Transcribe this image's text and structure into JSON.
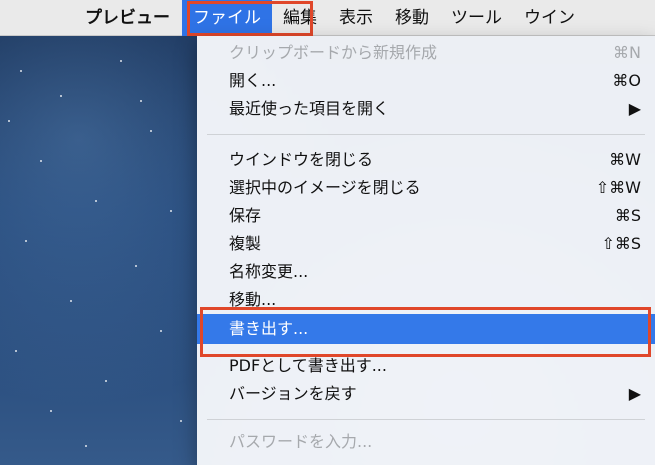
{
  "menubar": {
    "app_name": "プレビュー",
    "items": [
      "ファイル",
      "編集",
      "表示",
      "移動",
      "ツール",
      "ウイン"
    ],
    "active_item": "ファイル"
  },
  "file_menu": {
    "items": [
      {
        "label": "クリップボードから新規作成",
        "shortcut": "⌘N",
        "disabled": true
      },
      {
        "label": "開く...",
        "shortcut": "⌘O"
      },
      {
        "label": "最近使った項目を開く",
        "shortcut": "▶"
      },
      {
        "label": "ウインドウを閉じる",
        "shortcut": "⌘W"
      },
      {
        "label": "選択中のイメージを閉じる",
        "shortcut": "⇧⌘W"
      },
      {
        "label": "保存",
        "shortcut": "⌘S"
      },
      {
        "label": "複製",
        "shortcut": "⇧⌘S"
      },
      {
        "label": "名称変更..."
      },
      {
        "label": "移動..."
      },
      {
        "label": "書き出す...",
        "selected": true
      },
      {
        "label": "PDFとして書き出す..."
      },
      {
        "label": "バージョンを戻す",
        "shortcut": "▶"
      },
      {
        "label": "パスワードを入力...",
        "disabled": true
      }
    ]
  },
  "colors": {
    "menu_selection": "#3479e9",
    "annotation_border": "#e0472a"
  }
}
